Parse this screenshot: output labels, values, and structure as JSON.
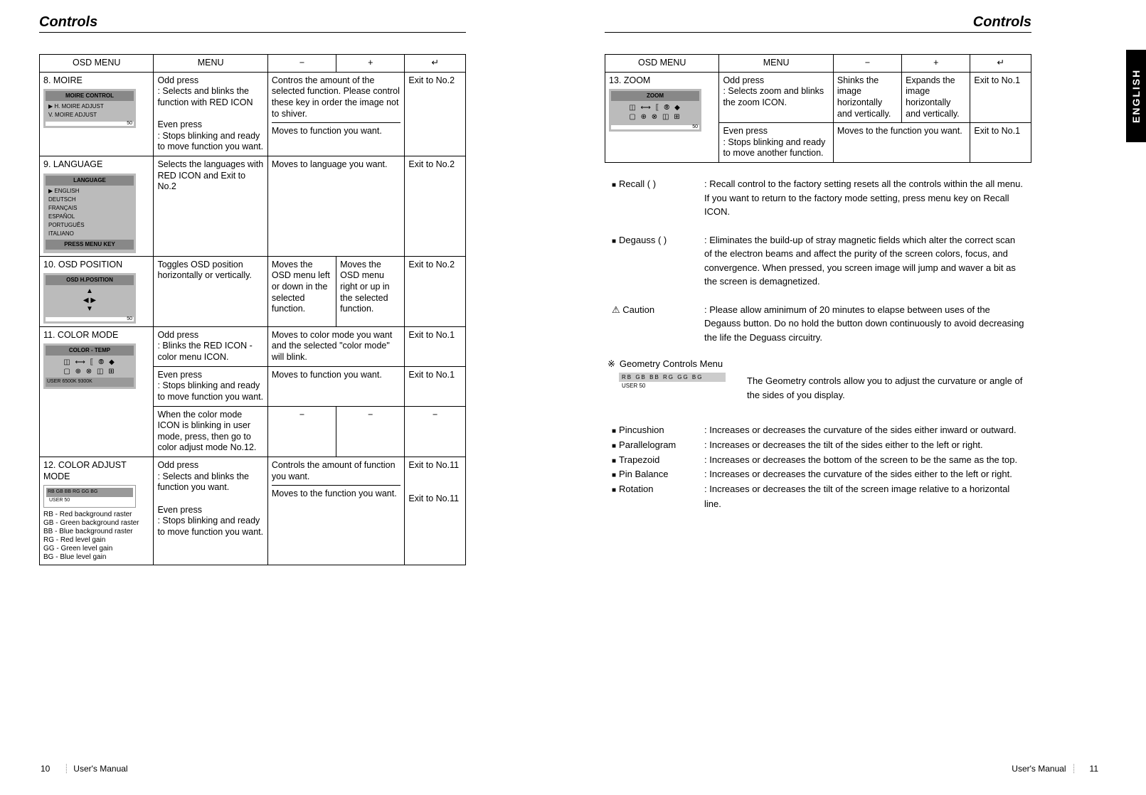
{
  "left": {
    "title": "Controls",
    "header": {
      "osd": "OSD MENU",
      "menu": "MENU",
      "minus": "−",
      "plus": "+",
      "enter": "↵"
    },
    "rows": {
      "moire": {
        "name": "8. MOIRE",
        "osd_title": "MOIRE CONTROL",
        "osd_l1": "▶  H. MOIRE ADJUST",
        "osd_l2": "    V. MOIRE ADJUST",
        "osd_val": "50",
        "menu_a": "Odd press\n: Selects and blinks the function with RED ICON",
        "menu_b": "Even press\n: Stops blinking and ready to move function you want.",
        "pm_a": "Contros the amount of the selected function. Please control these key in order the image not to shiver.",
        "pm_b": "Moves to function you want.",
        "enter": "Exit to No.2"
      },
      "language": {
        "name": "9. LANGUAGE",
        "osd_title": "LANGUAGE",
        "osd_l1": "▶  ENGLISH",
        "osd_l2": "    DEUTSCH",
        "osd_l3": "    FRANÇAIS",
        "osd_l4": "    ESPAÑOL",
        "osd_l5": "    PORTUGUÊS",
        "osd_l6": "    ITALIANO",
        "osd_foot": "PRESS MENU KEY",
        "menu": "Selects the languages with RED ICON and Exit to No.2",
        "pm": "Moves to language you want.",
        "enter": "Exit to No.2"
      },
      "osdpos": {
        "name": "10. OSD POSITION",
        "osd_title": "OSD H.POSITION",
        "osd_arrows": "▲\n◀ ▶\n▼",
        "osd_val": "50",
        "menu": "Toggles OSD position horizontally or vertically.",
        "minus": "Moves the OSD menu left or down in the selected function.",
        "plus": "Moves the OSD menu right or up in the selected function.",
        "enter": "Exit to No.2"
      },
      "colormode": {
        "name": "11. COLOR MODE",
        "osd_title": "COLOR - TEMP",
        "osd_icons": "◫ ⟷ ⟦ ⦾ ◆\n▢ ⊕ ⊗ ◫ ⊞",
        "osd_tabs": "USER   6500K   9300K",
        "menu_a": "Odd press\n: Blinks the RED ICON - color menu ICON.",
        "pm_a": "Moves to color mode you want and the selected \"color mode\" will blink.",
        "enter_a": "Exit to No.1",
        "menu_b": "Even press\n: Stops blinking and ready to move function you want.",
        "pm_b": "Moves to function you want.",
        "enter_b": "Exit to No.1",
        "menu_c": "When the color mode ICON is blinking in user mode, press, then go to color adjust mode No.12.",
        "pm_c_minus": "−",
        "pm_c_plus": "−",
        "enter_c": "−"
      },
      "coloradjust": {
        "name": "12. COLOR ADJUST MODE",
        "osd_tabs": "RB  GB  BB  RG  GG  BG",
        "osd_foot": "USER                       50",
        "note": "RB - Red background raster\nGB - Green background raster\nBB - Blue background raster\nRG - Red level gain\nGG - Green level gain\nBG - Blue level gain",
        "menu_a": "Odd press\n: Selects and blinks the function you want.",
        "pm_a": "Controls the amount of function you want.",
        "enter_a": "Exit to No.11",
        "menu_b": "Even press\n: Stops blinking and ready to move function you want.",
        "pm_b": "Moves to the function you want.",
        "enter_b": "Exit to No.11"
      }
    },
    "footer_page": "10",
    "footer_label": "User's Manual"
  },
  "right": {
    "title": "Controls",
    "header": {
      "osd": "OSD MENU",
      "menu": "MENU",
      "minus": "−",
      "plus": "+",
      "enter": "↵"
    },
    "zoom": {
      "name": "13. ZOOM",
      "osd_title": "ZOOM",
      "osd_icons": "◫ ⟷ ⟦ ⦾ ◆\n▢ ⊕ ⊗ ◫ ⊞",
      "osd_val": "50",
      "menu_a": "Odd press\n: Selects zoom and blinks the zoom ICON.",
      "minus_a": "Shinks the image horizontally and vertically.",
      "plus_a": "Expands the image horizontally and vertically.",
      "enter_a": "Exit to No.1",
      "menu_b": "Even press\n: Stops blinking and ready to move another function.",
      "pm_b": "Moves to the function you want.",
      "enter_b": "Exit to No.1"
    },
    "recall": {
      "label": "Recall (    )",
      "desc": ": Recall control to the factory setting resets all the controls within the all menu. If you want to return to the factory mode setting, press  menu  key on Recall  ICON."
    },
    "degauss": {
      "label": "Degauss (    )",
      "desc": ": Eliminates the build-up of stray magnetic fields which alter the correct scan of the electron beams and affect the purity of the screen colors, focus, and convergence. When pressed, you screen image will jump and waver a bit as the screen is demagnetized."
    },
    "caution": {
      "label": "⚠ Caution",
      "desc": ": Please allow aminimum of 20 minutes to elapse between uses of the Degauss button. Do no hold the button down continuously to avoid decreasing the life the Deguass circuitry."
    },
    "geometry": {
      "title": "Geometry Controls Menu",
      "bar_tabs": "RB  GB  BB  RG  GG  BG",
      "bar_foot": "USER                       50",
      "desc": "The Geometry controls allow you to adjust the curvature or angle of the sides of you display."
    },
    "defs": {
      "pincushion": {
        "term": "Pincushion",
        "desc": ": Increases or decreases the curvature of the sides either inward or outward."
      },
      "parallelogram": {
        "term": "Parallelogram",
        "desc": ": Increases or decreases the tilt of the sides either to the left or right."
      },
      "trapezoid": {
        "term": "Trapezoid",
        "desc": ": Increases or decreases the bottom of the screen to be the same as the top."
      },
      "pinbalance": {
        "term": "Pin Balance",
        "desc": ": Increases or decreases the curvature of the sides either to the left or right."
      },
      "rotation": {
        "term": "Rotation",
        "desc": ": Increases or decreases the tilt of the screen image relative to a horizontal line."
      }
    },
    "english_tab": "ENGLISH",
    "footer_label": "User's Manual",
    "footer_page": "11"
  }
}
